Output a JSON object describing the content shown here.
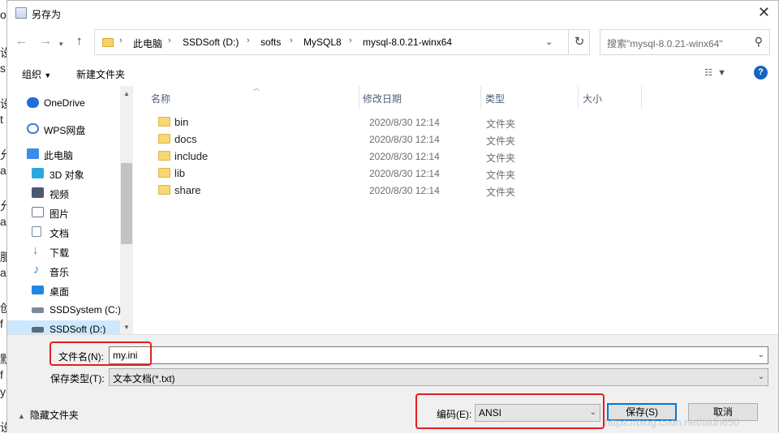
{
  "window": {
    "title": "另存为"
  },
  "nav": {
    "breadcrumbs": [
      "此电脑",
      "SSDSoft (D:)",
      "softs",
      "MySQL8",
      "mysql-8.0.21-winx64"
    ],
    "search_placeholder": "搜索\"mysql-8.0.21-winx64\""
  },
  "toolbar": {
    "organize": "组织",
    "new_folder": "新建文件夹"
  },
  "sidebar": {
    "items": [
      {
        "label": "OneDrive",
        "icon": "cloud-icon",
        "color": "#1e6fd9"
      },
      {
        "label": "WPS网盘",
        "icon": "cloud-outline-icon",
        "color": "#3d7fd9"
      },
      {
        "label": "此电脑",
        "icon": "computer-icon",
        "color": "#3a8ee6"
      },
      {
        "label": "3D 对象",
        "icon": "cube-icon",
        "color": "#29a8e0"
      },
      {
        "label": "视频",
        "icon": "film-icon",
        "color": "#4a5a70"
      },
      {
        "label": "图片",
        "icon": "picture-icon",
        "color": "#6a7a90"
      },
      {
        "label": "文档",
        "icon": "document-icon",
        "color": "#7a8aa0"
      },
      {
        "label": "下载",
        "icon": "download-icon",
        "color": "#2f7fd8"
      },
      {
        "label": "音乐",
        "icon": "music-icon",
        "color": "#2f7fd8"
      },
      {
        "label": "桌面",
        "icon": "desktop-icon",
        "color": "#1e88e5"
      },
      {
        "label": "SSDSystem (C:)",
        "icon": "drive-icon",
        "color": "#5a6a7a"
      },
      {
        "label": "SSDSoft (D:)",
        "icon": "drive-icon",
        "color": "#5a6a7a"
      }
    ]
  },
  "columns": [
    "名称",
    "修改日期",
    "类型",
    "大小"
  ],
  "files": [
    {
      "name": "bin",
      "date": "2020/8/30 12:14",
      "type": "文件夹"
    },
    {
      "name": "docs",
      "date": "2020/8/30 12:14",
      "type": "文件夹"
    },
    {
      "name": "include",
      "date": "2020/8/30 12:14",
      "type": "文件夹"
    },
    {
      "name": "lib",
      "date": "2020/8/30 12:14",
      "type": "文件夹"
    },
    {
      "name": "share",
      "date": "2020/8/30 12:14",
      "type": "文件夹"
    }
  ],
  "save": {
    "filename_label": "文件名(N):",
    "filename_value": "my.ini",
    "type_label": "保存类型(T):",
    "type_value": "文本文档(*.txt)",
    "hide_folders": "隐藏文件夹",
    "encoding_label": "编码(E):",
    "encoding_value": "ANSI",
    "save_button": "保存(S)",
    "cancel_button": "取消"
  },
  "watermark": "https://blog.csdn.net/aidn650",
  "background_glyphs": [
    "or",
    "设",
    "s",
    "设",
    "t",
    "允",
    "a",
    "允",
    "a",
    "服",
    "a",
    "创",
    "f",
    "默",
    "f",
    "y",
    "设"
  ],
  "colors": {
    "accent": "#0078d7",
    "selection": "#cce8ff",
    "highlight_box": "#e02020"
  }
}
